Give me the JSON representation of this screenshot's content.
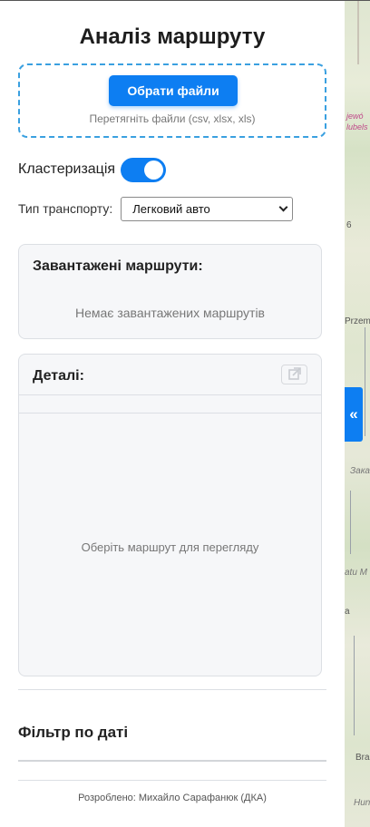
{
  "sidebar": {
    "title": "Аналіз маршруту",
    "upload": {
      "button_label": "Обрати файли",
      "hint": "Перетягніть файли (csv, xlsx, xls)"
    },
    "clustering": {
      "label": "Кластеризація",
      "enabled": true
    },
    "transport": {
      "label": "Тип транспорту:",
      "selected": "Легковий авто"
    },
    "loaded_routes": {
      "heading": "Завантажені маршрути:",
      "empty_text": "Немає завантажених маршрутів"
    },
    "details": {
      "heading": "Деталі:",
      "empty_text": "Оберіть маршрут для перегляду"
    },
    "date_filter": {
      "heading": "Фільтр по даті"
    },
    "footer": "Розроблено: Михайло Сарафанюк (ДКА)"
  },
  "map": {
    "collapse_toggle": "«",
    "labels": {
      "wojewodztwo": "jewó",
      "lubelskie": "lubels",
      "przem": "Przem",
      "zakar": "Зака",
      "atu": "atu M",
      "a": "a",
      "bra": "Bra",
      "hun": "Hun"
    }
  },
  "colors": {
    "accent": "#0d7ef2",
    "dropzone_border": "#3aa0e0",
    "card_bg": "#f6f7f9"
  }
}
